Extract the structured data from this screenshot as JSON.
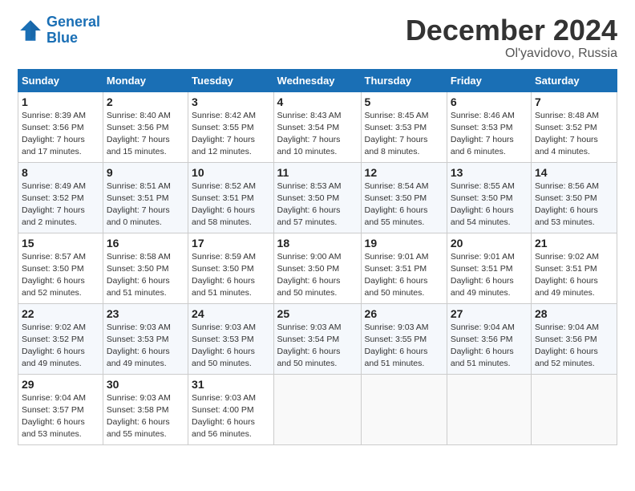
{
  "header": {
    "logo_line1": "General",
    "logo_line2": "Blue",
    "month": "December 2024",
    "location": "Ol'yavidovo, Russia"
  },
  "weekdays": [
    "Sunday",
    "Monday",
    "Tuesday",
    "Wednesday",
    "Thursday",
    "Friday",
    "Saturday"
  ],
  "weeks": [
    [
      {
        "day": "1",
        "info": "Sunrise: 8:39 AM\nSunset: 3:56 PM\nDaylight: 7 hours\nand 17 minutes."
      },
      {
        "day": "2",
        "info": "Sunrise: 8:40 AM\nSunset: 3:56 PM\nDaylight: 7 hours\nand 15 minutes."
      },
      {
        "day": "3",
        "info": "Sunrise: 8:42 AM\nSunset: 3:55 PM\nDaylight: 7 hours\nand 12 minutes."
      },
      {
        "day": "4",
        "info": "Sunrise: 8:43 AM\nSunset: 3:54 PM\nDaylight: 7 hours\nand 10 minutes."
      },
      {
        "day": "5",
        "info": "Sunrise: 8:45 AM\nSunset: 3:53 PM\nDaylight: 7 hours\nand 8 minutes."
      },
      {
        "day": "6",
        "info": "Sunrise: 8:46 AM\nSunset: 3:53 PM\nDaylight: 7 hours\nand 6 minutes."
      },
      {
        "day": "7",
        "info": "Sunrise: 8:48 AM\nSunset: 3:52 PM\nDaylight: 7 hours\nand 4 minutes."
      }
    ],
    [
      {
        "day": "8",
        "info": "Sunrise: 8:49 AM\nSunset: 3:52 PM\nDaylight: 7 hours\nand 2 minutes."
      },
      {
        "day": "9",
        "info": "Sunrise: 8:51 AM\nSunset: 3:51 PM\nDaylight: 7 hours\nand 0 minutes."
      },
      {
        "day": "10",
        "info": "Sunrise: 8:52 AM\nSunset: 3:51 PM\nDaylight: 6 hours\nand 58 minutes."
      },
      {
        "day": "11",
        "info": "Sunrise: 8:53 AM\nSunset: 3:50 PM\nDaylight: 6 hours\nand 57 minutes."
      },
      {
        "day": "12",
        "info": "Sunrise: 8:54 AM\nSunset: 3:50 PM\nDaylight: 6 hours\nand 55 minutes."
      },
      {
        "day": "13",
        "info": "Sunrise: 8:55 AM\nSunset: 3:50 PM\nDaylight: 6 hours\nand 54 minutes."
      },
      {
        "day": "14",
        "info": "Sunrise: 8:56 AM\nSunset: 3:50 PM\nDaylight: 6 hours\nand 53 minutes."
      }
    ],
    [
      {
        "day": "15",
        "info": "Sunrise: 8:57 AM\nSunset: 3:50 PM\nDaylight: 6 hours\nand 52 minutes."
      },
      {
        "day": "16",
        "info": "Sunrise: 8:58 AM\nSunset: 3:50 PM\nDaylight: 6 hours\nand 51 minutes."
      },
      {
        "day": "17",
        "info": "Sunrise: 8:59 AM\nSunset: 3:50 PM\nDaylight: 6 hours\nand 51 minutes."
      },
      {
        "day": "18",
        "info": "Sunrise: 9:00 AM\nSunset: 3:50 PM\nDaylight: 6 hours\nand 50 minutes."
      },
      {
        "day": "19",
        "info": "Sunrise: 9:01 AM\nSunset: 3:51 PM\nDaylight: 6 hours\nand 50 minutes."
      },
      {
        "day": "20",
        "info": "Sunrise: 9:01 AM\nSunset: 3:51 PM\nDaylight: 6 hours\nand 49 minutes."
      },
      {
        "day": "21",
        "info": "Sunrise: 9:02 AM\nSunset: 3:51 PM\nDaylight: 6 hours\nand 49 minutes."
      }
    ],
    [
      {
        "day": "22",
        "info": "Sunrise: 9:02 AM\nSunset: 3:52 PM\nDaylight: 6 hours\nand 49 minutes."
      },
      {
        "day": "23",
        "info": "Sunrise: 9:03 AM\nSunset: 3:53 PM\nDaylight: 6 hours\nand 49 minutes."
      },
      {
        "day": "24",
        "info": "Sunrise: 9:03 AM\nSunset: 3:53 PM\nDaylight: 6 hours\nand 50 minutes."
      },
      {
        "day": "25",
        "info": "Sunrise: 9:03 AM\nSunset: 3:54 PM\nDaylight: 6 hours\nand 50 minutes."
      },
      {
        "day": "26",
        "info": "Sunrise: 9:03 AM\nSunset: 3:55 PM\nDaylight: 6 hours\nand 51 minutes."
      },
      {
        "day": "27",
        "info": "Sunrise: 9:04 AM\nSunset: 3:56 PM\nDaylight: 6 hours\nand 51 minutes."
      },
      {
        "day": "28",
        "info": "Sunrise: 9:04 AM\nSunset: 3:56 PM\nDaylight: 6 hours\nand 52 minutes."
      }
    ],
    [
      {
        "day": "29",
        "info": "Sunrise: 9:04 AM\nSunset: 3:57 PM\nDaylight: 6 hours\nand 53 minutes."
      },
      {
        "day": "30",
        "info": "Sunrise: 9:03 AM\nSunset: 3:58 PM\nDaylight: 6 hours\nand 55 minutes."
      },
      {
        "day": "31",
        "info": "Sunrise: 9:03 AM\nSunset: 4:00 PM\nDaylight: 6 hours\nand 56 minutes."
      },
      null,
      null,
      null,
      null
    ]
  ]
}
